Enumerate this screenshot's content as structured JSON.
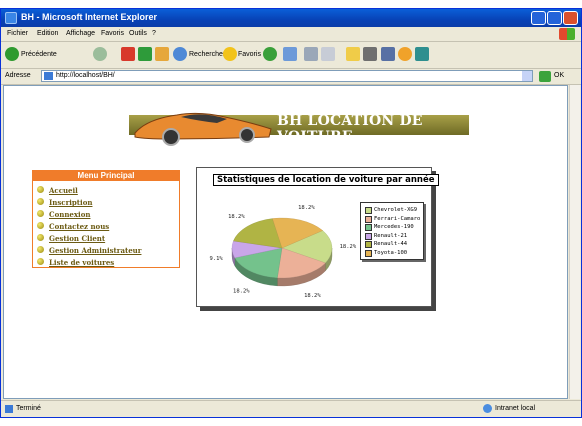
{
  "window": {
    "title": "BH - Microsoft Internet Explorer"
  },
  "menubar": [
    "Fichier",
    "Edition",
    "Affichage",
    "Favoris",
    "Outils",
    "?"
  ],
  "toolbar": {
    "back": "Précédente",
    "search": "Rechercher",
    "favorites": "Favoris"
  },
  "address": {
    "label": "Adresse",
    "url": "http://localhost/BH/",
    "go": "OK"
  },
  "status": {
    "left": "Terminé",
    "right": "Intranet local"
  },
  "banner": {
    "title": "BH LOCATION DE VOITURE"
  },
  "menu": {
    "title": "Menu Principal",
    "items": [
      "Accueil",
      "Inscription",
      "Connexion",
      "Contactez nous",
      "Gestion Client",
      "Gestion Administrateur",
      "Liste de voitures"
    ]
  },
  "chart_data": {
    "type": "pie",
    "title": "Statistiques de location de voiture par année",
    "slices": [
      {
        "name": "Chevrolet-XG9",
        "value": 18.2,
        "label": "18.2%",
        "color": "#c8dc8a"
      },
      {
        "name": "Ferrari-Camaro",
        "value": 18.2,
        "label": "18.2%",
        "color": "#ecb098"
      },
      {
        "name": "Mercedes-190",
        "value": 18.2,
        "label": "18.2%",
        "color": "#74c28c"
      },
      {
        "name": "Renault-21",
        "value": 9.1,
        "label": "9.1%",
        "color": "#c9a6e9"
      },
      {
        "name": "Renault-44",
        "value": 18.2,
        "label": "18.2%",
        "color": "#b0b444"
      },
      {
        "name": "Toyota-100",
        "value": 18.2,
        "label": "18.2%",
        "color": "#e6b454"
      }
    ],
    "legend_position": "right"
  }
}
